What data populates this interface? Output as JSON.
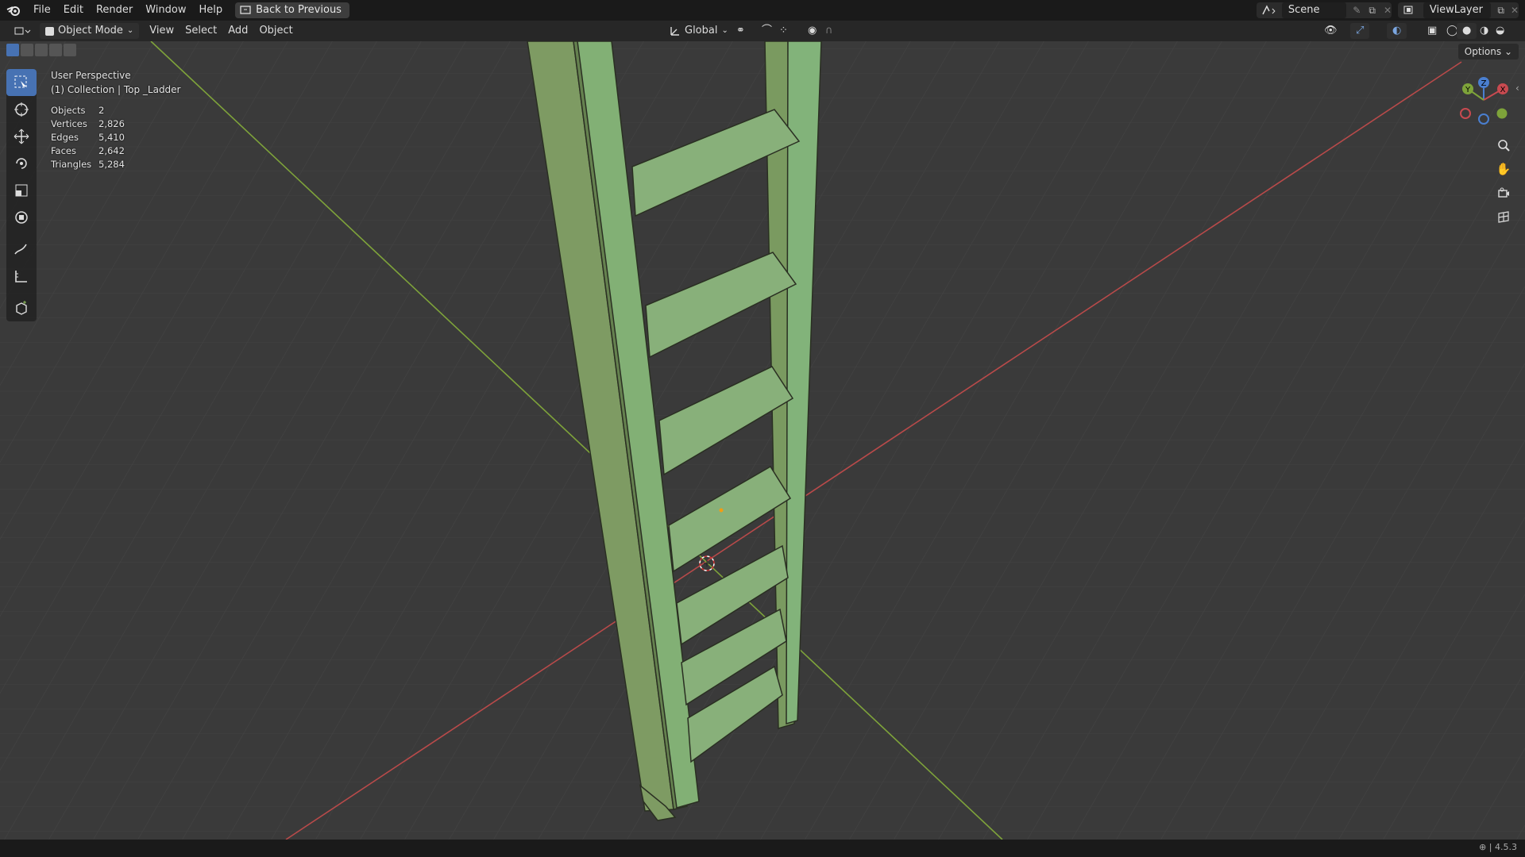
{
  "menu": {
    "file": "File",
    "edit": "Edit",
    "render": "Render",
    "window": "Window",
    "help": "Help",
    "back": "Back to Previous"
  },
  "scene": {
    "label": "Scene"
  },
  "viewlayer": {
    "label": "ViewLayer"
  },
  "header": {
    "mode": "Object Mode",
    "view": "View",
    "select": "Select",
    "add": "Add",
    "object": "Object",
    "orientation": "Global",
    "options": "Options"
  },
  "viewport": {
    "perspective": "User Perspective",
    "collection": "(1) Collection | Top _Ladder",
    "stats": [
      {
        "k": "Objects",
        "v": "2"
      },
      {
        "k": "Vertices",
        "v": "2,826"
      },
      {
        "k": "Edges",
        "v": "5,410"
      },
      {
        "k": "Faces",
        "v": "2,642"
      },
      {
        "k": "Triangles",
        "v": "5,284"
      }
    ]
  },
  "gizmo": {
    "x": "X",
    "y": "Y",
    "z": "Z"
  },
  "status": {
    "version": "4.5.3"
  },
  "colors": {
    "accent": "#4772b3",
    "grid": "#3b3b3b",
    "mesh": "#7fb07a",
    "xaxis": "#b84a4a",
    "yaxis": "#7ea33a"
  }
}
